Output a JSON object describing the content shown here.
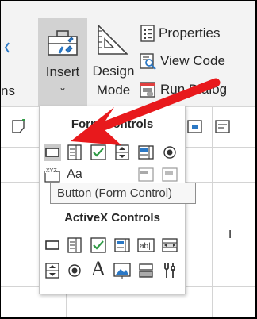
{
  "ribbon": {
    "left_edge_text": "ns",
    "insert": {
      "label": "Insert",
      "chevron": "⌄",
      "icon": "toolbox-icon"
    },
    "design_mode": {
      "line1": "Design",
      "line2": "Mode",
      "icon": "design-mode-icon"
    },
    "properties": {
      "label": "Properties",
      "icon": "properties-icon"
    },
    "view_code": {
      "label": "View Code",
      "icon": "view-code-icon"
    },
    "run_dialog": {
      "label": "Run Dialog",
      "icon": "run-dialog-icon"
    }
  },
  "dropdown": {
    "form_controls_heading": "Form Controls",
    "form_controls": [
      "button",
      "combo-box",
      "check-box",
      "spin-button",
      "list-box",
      "option-button",
      "group-box",
      "label",
      "scroll-bar",
      "text-field",
      "combo-list-edit",
      "combo-drop-down-edit"
    ],
    "activex_heading": "ActiveX Controls",
    "activex_controls": [
      "command-button",
      "combo-box",
      "check-box",
      "list-box",
      "text-box",
      "scroll-bar",
      "spin-button",
      "option-button",
      "label",
      "image",
      "toggle-button",
      "more-controls"
    ],
    "partial_text": "XYZ",
    "partial_aa": "Aa"
  },
  "tooltip": {
    "text": "Button (Form Control)"
  },
  "sheet": {
    "cursor_glyph": "I"
  },
  "colors": {
    "arrow": "#e8191c",
    "checkmark": "#2e9a44",
    "selection": "#c9c9c9"
  }
}
